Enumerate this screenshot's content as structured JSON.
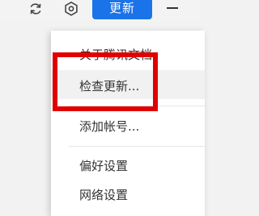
{
  "toolbar": {
    "refresh_icon": "refresh-icon",
    "settings_icon": "gear-icon",
    "update_label": "更新",
    "minimize_icon": "minimize-icon",
    "accent_color": "#1a73e8"
  },
  "menu": {
    "items": [
      {
        "label": "关于腾讯文档"
      },
      {
        "label": "检查更新..."
      },
      {
        "label": "添加帐号..."
      },
      {
        "label": "偏好设置"
      },
      {
        "label": "网络设置"
      }
    ]
  },
  "annotation": {
    "highlight_color": "#e00000"
  }
}
